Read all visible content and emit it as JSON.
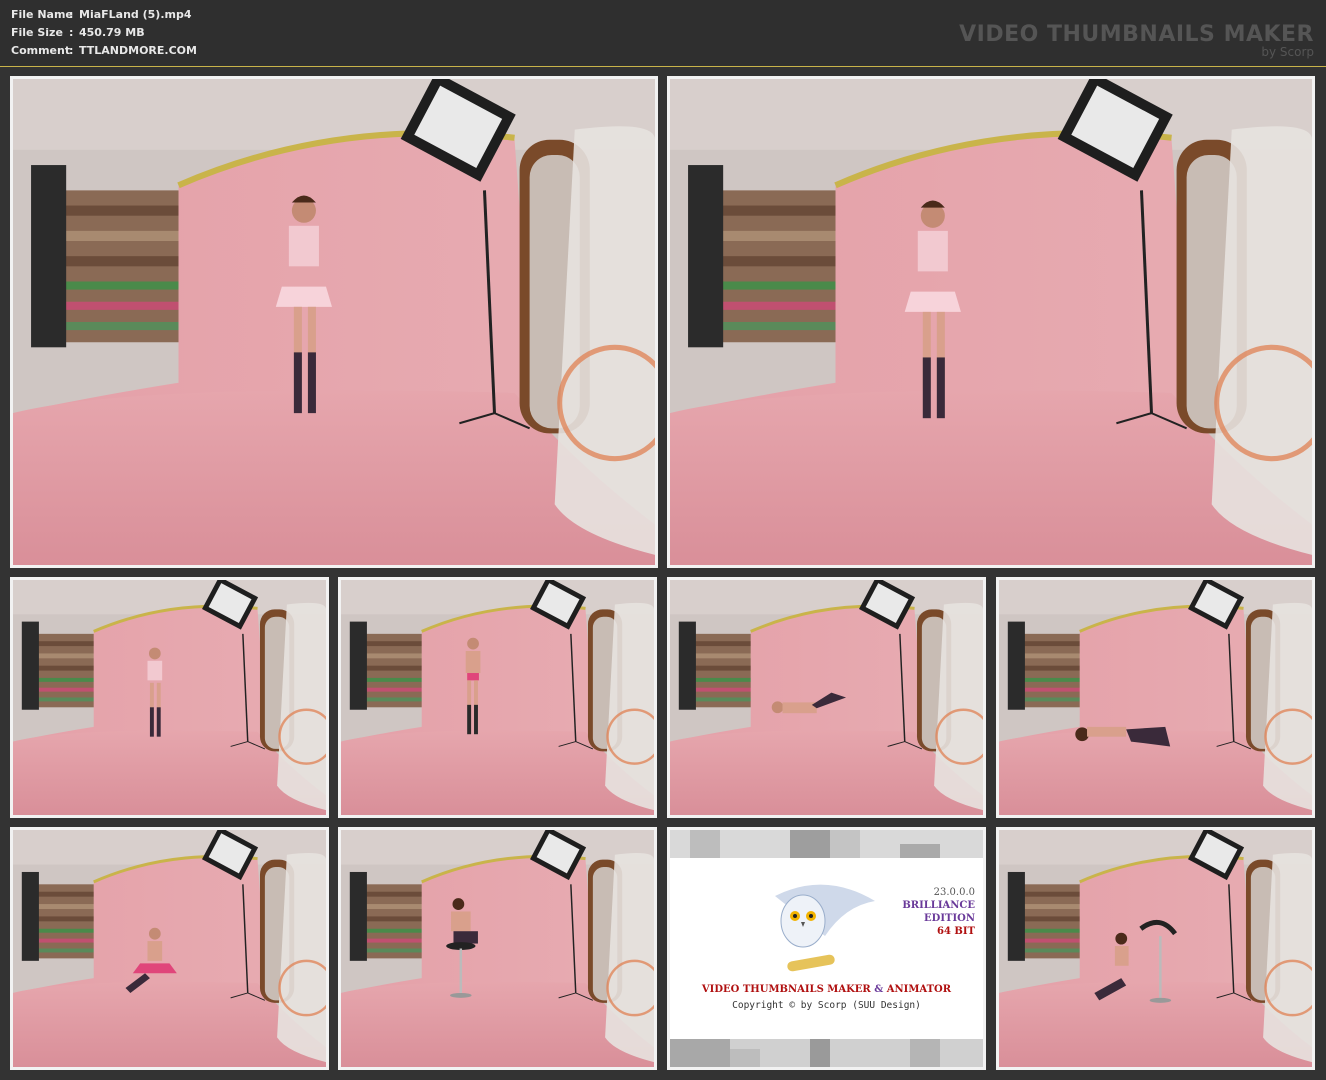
{
  "header": {
    "file_name_label": "File Name",
    "file_name": "MiaFLand (5).mp4",
    "file_size_label": "File Size",
    "file_size": "450.79 MB",
    "comment_label": "Comment",
    "comment": "TTLANDMORE.COM",
    "separator": ":",
    "brand_title": "VIDEO THUMBNAILS MAKER",
    "brand_sub": "by Scorp"
  },
  "thumbnails": [
    {
      "id": 1,
      "pose": "standing"
    },
    {
      "id": 2,
      "pose": "standing"
    },
    {
      "id": 3,
      "pose": "standing"
    },
    {
      "id": 4,
      "pose": "standing"
    },
    {
      "id": 5,
      "pose": "lying"
    },
    {
      "id": 6,
      "pose": "crawling"
    },
    {
      "id": 7,
      "pose": "sitting"
    },
    {
      "id": 8,
      "pose": "on-stool"
    },
    {
      "id": 9,
      "pose": "promo"
    },
    {
      "id": 10,
      "pose": "sitting-by-stool"
    }
  ],
  "promo_card": {
    "version": "23.0.0.0",
    "edition_line1": "BRILLIANCE",
    "edition_line2": "EDITION",
    "bits": "64 BIT",
    "title_part1": "VIDEO THUMBNAILS MAKER",
    "title_amp": " & ",
    "title_part2": "ANIMATOR",
    "copyright": "Copyright © by Scorp (SUU Design)"
  },
  "colors": {
    "background": "#333333",
    "frame": "#f2f2f2",
    "backdrop_pink": "#e3a1a8",
    "accent_gold": "#c9b44a"
  }
}
